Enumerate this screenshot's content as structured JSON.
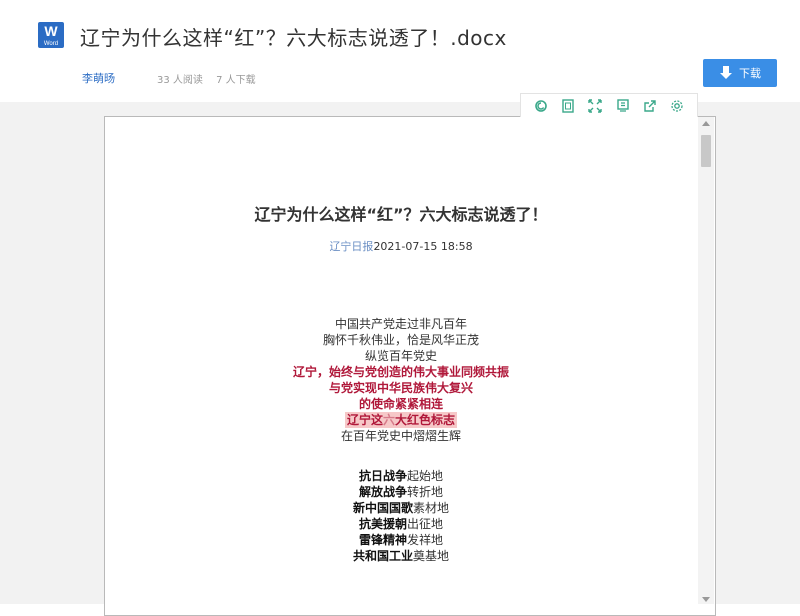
{
  "header": {
    "doc_title": "辽宁为什么这样“红”？六大标志说透了！.docx",
    "icon_letter": "W",
    "icon_sub": "Word",
    "author": "李萌旸",
    "reads": "33 人阅读",
    "downloads": "7 人下载",
    "download_label": "下载"
  },
  "toolbar": [
    "search-icon",
    "fit-page-icon",
    "fullscreen-icon",
    "print-icon",
    "share-icon",
    "settings-icon"
  ],
  "document": {
    "title": "辽宁为什么这样“红”？六大标志说透了！",
    "source": "辽宁日报",
    "datetime": "2021-07-15 18:58",
    "intro_lines": [
      "中国共产党走过非凡百年",
      "胸怀千秋伟业，恰是风华正茂",
      "纵览百年党史"
    ],
    "red_lines": [
      "辽宁，始终与党创造的伟大事业同频共振",
      "与党实现中华民族伟大复兴",
      "的使命紧紧相连"
    ],
    "highlight_a": "辽宁这",
    "highlight_b": "六",
    "highlight_c": "大红色标志",
    "glow_line": "在百年党史中熠熠生辉",
    "list": [
      {
        "bold": "抗日战争",
        "rest": "起始地"
      },
      {
        "bold": "解放战争",
        "rest": "转折地"
      },
      {
        "bold": "新中国国歌",
        "rest": "素材地"
      },
      {
        "bold": "抗美援朝",
        "rest": "出征地"
      },
      {
        "bold": "雷锋精神",
        "rest": "发祥地"
      },
      {
        "bold": "共和国工业",
        "rest": "奠基地"
      }
    ]
  },
  "colors": {
    "accent": "#3a8ee6",
    "red_text": "#b0183a",
    "toolbar_icon": "#3aa88a"
  }
}
